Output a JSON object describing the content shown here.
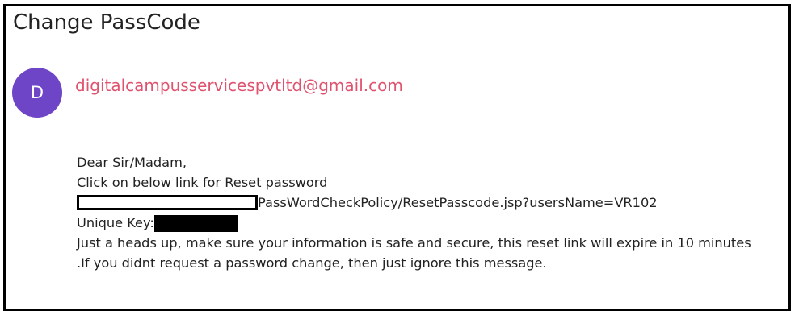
{
  "email": {
    "subject": "Change PassCode",
    "sender": {
      "avatar_letter": "D",
      "address": "digitalcampusservicespvtltd@gmail.com",
      "avatar_color": "#6f45c7",
      "address_color": "#e0536f"
    },
    "body": {
      "greeting": "Dear Sir/Madam,",
      "instruction": "Click on below link for Reset password",
      "link_path": "PassWordCheckPolicy/ResetPasscode.jsp?usersName=VR102",
      "unique_key_label": "Unique Key:",
      "notice_line_1": "Just a heads up, make sure your information is safe and secure, this reset link will expire in 10 minutes",
      "notice_line_2": ".If you didnt request a password change, then just ignore this message."
    }
  }
}
